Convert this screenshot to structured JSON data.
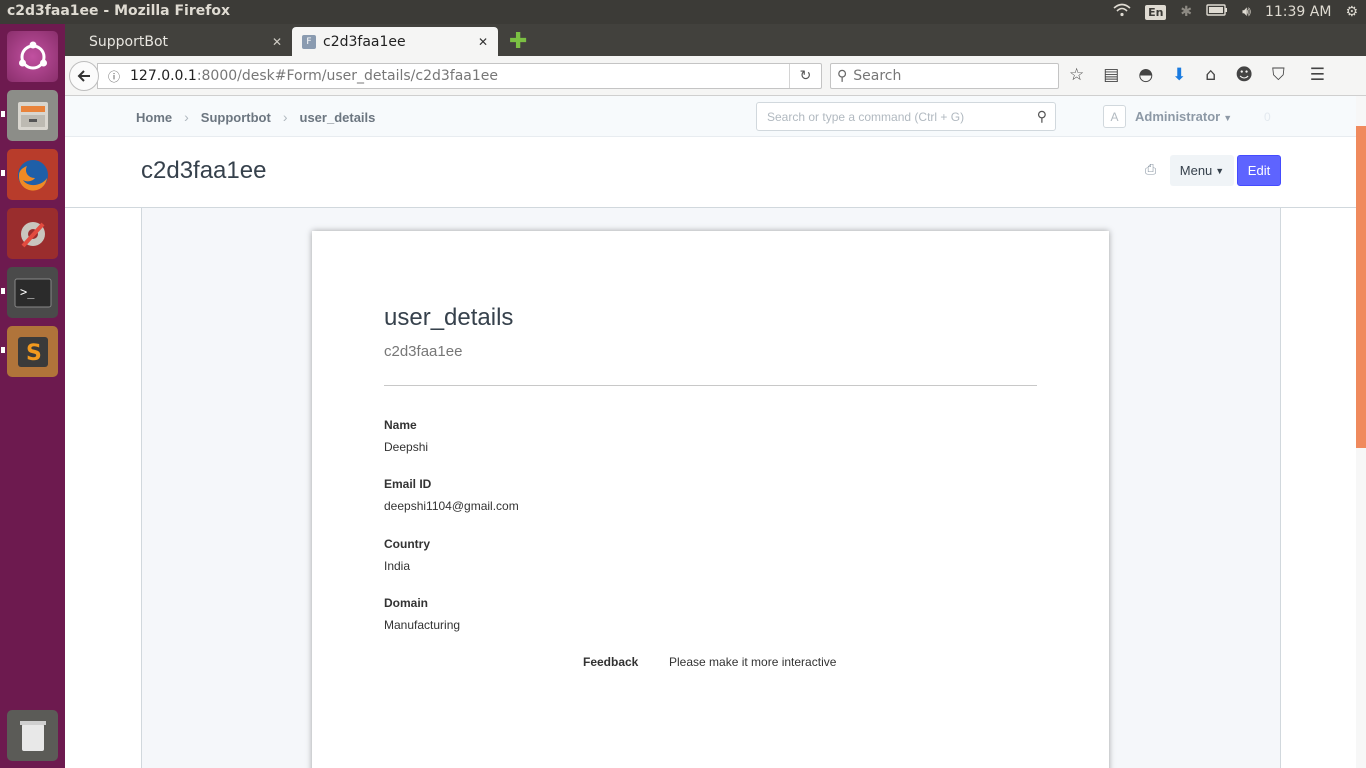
{
  "system": {
    "window_title": "c2d3faa1ee - Mozilla Firefox",
    "keyboard_layout": "En",
    "clock": "11:39 AM"
  },
  "browser": {
    "tabs": [
      {
        "label": "SupportBot",
        "active": false
      },
      {
        "label": "c2d3faa1ee",
        "active": true,
        "favicon_letter": "F"
      }
    ],
    "url_host": "127.0.0.1",
    "url_rest": ":8000/desk#Form/user_details/c2d3faa1ee",
    "search_placeholder": "Search"
  },
  "desk": {
    "breadcrumbs": [
      "Home",
      "Supportbot",
      "user_details"
    ],
    "awesome_bar_placeholder": "Search or type a command (Ctrl + G)",
    "avatar_letter": "A",
    "user_name": "Administrator",
    "notification_count": "0"
  },
  "page": {
    "title": "c2d3faa1ee",
    "menu_label": "Menu",
    "edit_label": "Edit"
  },
  "document": {
    "doctype": "user_details",
    "name": "c2d3faa1ee",
    "fields": [
      {
        "label": "Name",
        "value": "Deepshi"
      },
      {
        "label": "Email ID",
        "value": "deepshi1104@gmail.com"
      },
      {
        "label": "Country",
        "value": "India"
      },
      {
        "label": "Domain",
        "value": "Manufacturing"
      }
    ],
    "feedback_label": "Feedback",
    "feedback_value": "Please make it more interactive"
  },
  "colors": {
    "launcher_bg": "#6d1a4f",
    "panel_bg": "#3c3b37",
    "edit_button": "#5e64ff",
    "scrollbar_thumb": "#f08a5d"
  }
}
